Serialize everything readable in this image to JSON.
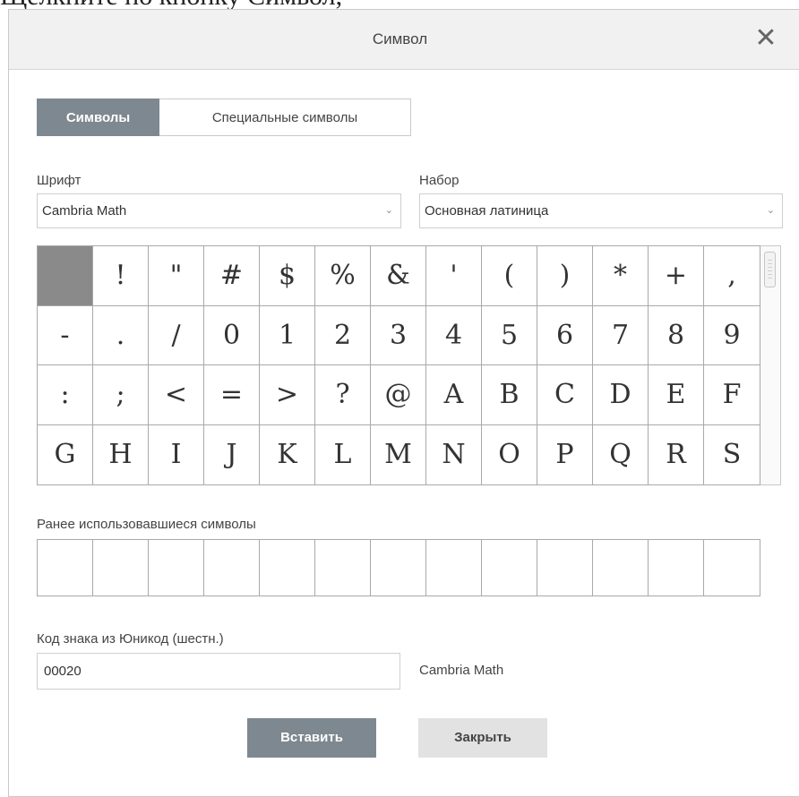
{
  "background_text": "Щелкните по кнопку Символ,",
  "dialog": {
    "title": "Символ",
    "close_glyph": "✕"
  },
  "tabs": [
    {
      "label": "Символы",
      "active": true
    },
    {
      "label": "Специальные символы",
      "active": false
    }
  ],
  "font": {
    "label": "Шрифт",
    "value": "Cambria Math",
    "chevron": "⌄"
  },
  "subset": {
    "label": "Набор",
    "value": "Основная латиница",
    "chevron": "⌄"
  },
  "symbols": {
    "selected_index": 0,
    "cells": [
      " ",
      "!",
      "\"",
      "#",
      "$",
      "%",
      "&",
      "'",
      "(",
      ")",
      "*",
      "+",
      ",",
      "-",
      ".",
      "/",
      "0",
      "1",
      "2",
      "3",
      "4",
      "5",
      "6",
      "7",
      "8",
      "9",
      ":",
      ";",
      "<",
      "=",
      ">",
      "?",
      "@",
      "A",
      "B",
      "C",
      "D",
      "E",
      "F",
      "G",
      "H",
      "I",
      "J",
      "K",
      "L",
      "M",
      "N",
      "O",
      "P",
      "Q",
      "R",
      "S"
    ]
  },
  "recent": {
    "label": "Ранее использовавшиеся символы",
    "cells": [
      "",
      "",
      "",
      "",
      "",
      "",
      "",
      "",
      "",
      "",
      "",
      "",
      ""
    ]
  },
  "unicode": {
    "label": "Код знака из Юникод (шестн.)",
    "value": "00020",
    "font_name": "Cambria Math"
  },
  "buttons": {
    "insert": "Вставить",
    "close": "Закрыть"
  },
  "colors": {
    "primary_button": "#7e8890",
    "selected_cell": "#8a8a8a",
    "secondary_button": "#e2e2e2"
  }
}
